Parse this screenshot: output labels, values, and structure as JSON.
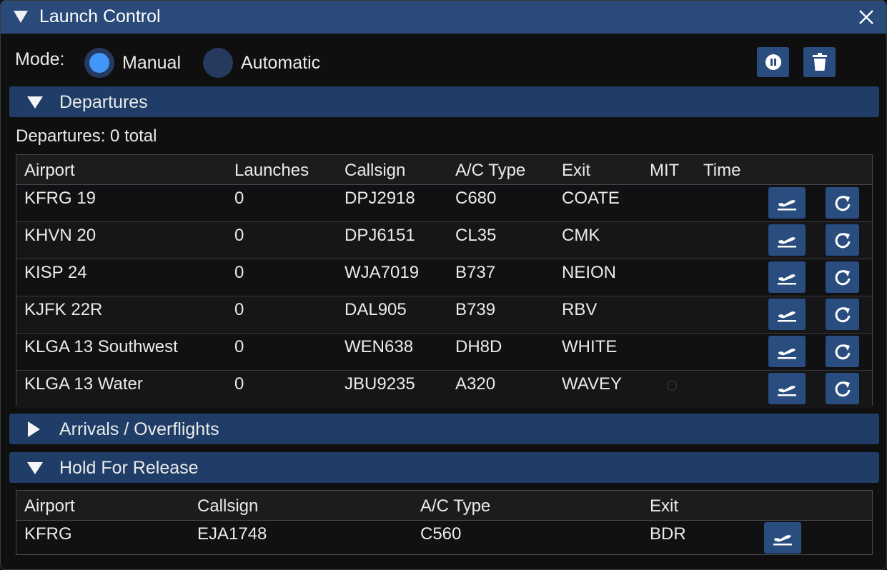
{
  "window": {
    "title": "Launch Control"
  },
  "mode": {
    "label": "Mode:",
    "options": [
      {
        "label": "Manual",
        "selected": true
      },
      {
        "label": "Automatic",
        "selected": false
      }
    ]
  },
  "toolbar": {
    "pause_icon": "pause-icon",
    "delete_icon": "trash-icon"
  },
  "departures": {
    "header": "Departures",
    "expanded": true,
    "summary": "Departures: 0 total",
    "columns": [
      "Airport",
      "Launches",
      "Callsign",
      "A/C Type",
      "Exit",
      "MIT",
      "Time"
    ],
    "rows": [
      {
        "airport": "KFRG 19",
        "launches": "0",
        "callsign": "DPJ2918",
        "actype": "C680",
        "exit": "COATE",
        "mit": "",
        "time": ""
      },
      {
        "airport": "KHVN 20",
        "launches": "0",
        "callsign": "DPJ6151",
        "actype": "CL35",
        "exit": "CMK",
        "mit": "",
        "time": ""
      },
      {
        "airport": "KISP 24",
        "launches": "0",
        "callsign": "WJA7019",
        "actype": "B737",
        "exit": "NEION",
        "mit": "",
        "time": ""
      },
      {
        "airport": "KJFK 22R",
        "launches": "0",
        "callsign": "DAL905",
        "actype": "B739",
        "exit": "RBV",
        "mit": "",
        "time": ""
      },
      {
        "airport": "KLGA 13 Southwest",
        "launches": "0",
        "callsign": "WEN638",
        "actype": "DH8D",
        "exit": "WHITE",
        "mit": "",
        "time": ""
      },
      {
        "airport": "KLGA 13 Water",
        "launches": "0",
        "callsign": "JBU9235",
        "actype": "A320",
        "exit": "WAVEY",
        "mit": "",
        "time": ""
      }
    ]
  },
  "arrivals": {
    "header": "Arrivals / Overflights",
    "expanded": false
  },
  "hold": {
    "header": "Hold For Release",
    "expanded": true,
    "columns": [
      "Airport",
      "Callsign",
      "A/C Type",
      "Exit"
    ],
    "rows": [
      {
        "airport": "KFRG",
        "callsign": "EJA1748",
        "actype": "C560",
        "exit": "BDR"
      }
    ]
  },
  "colors": {
    "titlebar": "#2a4a7a",
    "section_header": "#1f3d66",
    "button": "#2a4d80",
    "radio_selected": "#4296fa",
    "background": "#0f0f10"
  }
}
